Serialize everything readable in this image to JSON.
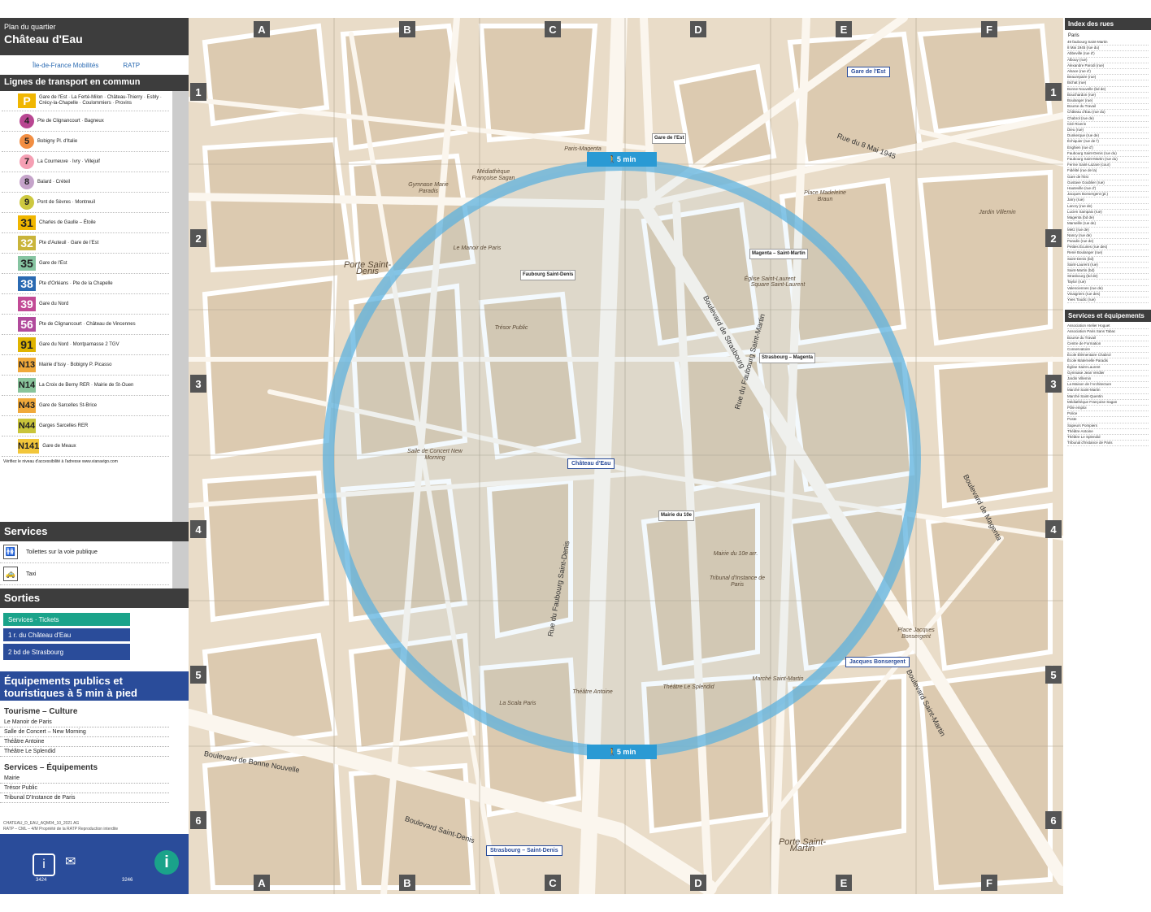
{
  "header": {
    "plan_label": "Plan du quartier",
    "place_name": "Château d'Eau",
    "logo_idf": "Île-de-France Mobilités",
    "logo_ratp": "RATP"
  },
  "transport": {
    "title": "Lignes de transport en commun",
    "rer_lines": [
      {
        "badge": "P",
        "dest": "Gare de l'Est · La Ferté-Milon · Château-Thierry · Esbly · Crécy-la-Chapelle · Coulommiers · Provins"
      }
    ],
    "metro_lines": [
      {
        "num": "4",
        "color": "#b94792",
        "dest": "Pte de Clignancourt · Bagneux"
      },
      {
        "num": "5",
        "color": "#f28e42",
        "dest": "Bobigny Pl. d'Italie"
      },
      {
        "num": "7",
        "color": "#f59fb3",
        "dest": "La Courneuve · Ivry · Villejuif"
      },
      {
        "num": "8",
        "color": "#c5a3ca",
        "dest": "Balard · Créteil"
      },
      {
        "num": "9",
        "color": "#cdc83f",
        "dest": "Pont de Sèvres · Montreuil"
      }
    ],
    "bus_lines": [
      {
        "num": "31",
        "color": "#f0b600",
        "text": "#222",
        "dest": "Charles de Gaulle – Étoile"
      },
      {
        "num": "32",
        "color": "#c9b43a",
        "text": "#fff",
        "dest": "Pte d'Auteuil · Gare de l'Est"
      },
      {
        "num": "35",
        "color": "#86c4a1",
        "text": "#222",
        "dest": "Gare de l'Est"
      },
      {
        "num": "38",
        "color": "#2a6ab2",
        "text": "#fff",
        "dest": "Pte d'Orléans · Pte de la Chapelle"
      },
      {
        "num": "39",
        "color": "#c24a96",
        "text": "#fff",
        "dest": "Gare du Nord"
      },
      {
        "num": "56",
        "color": "#b14a9c",
        "text": "#fff",
        "dest": "Pte de Clignancourt · Château de Vincennes"
      },
      {
        "num": "91",
        "color": "#e0b400",
        "text": "#222",
        "dest": "Gare du Nord · Montparnasse 2 TGV"
      }
    ],
    "noctilien_lines": [
      {
        "num": "N13",
        "color": "#f0a93a",
        "dest": "Mairie d'Issy · Bobigny P. Picasso"
      },
      {
        "num": "N14",
        "color": "#88c49b",
        "dest": "La Croix de Berny RER · Mairie de St-Ouen"
      },
      {
        "num": "N43",
        "color": "#f0a93a",
        "dest": "Gare de Sarcelles St-Brice"
      },
      {
        "num": "N44",
        "color": "#c9c43a",
        "dest": "Garges Sarcelles RER"
      },
      {
        "num": "N141",
        "color": "#f2c63a",
        "dest": "Gare de Meaux"
      }
    ],
    "note": "Vérifiez le niveau d'accessibilité à l'adresse www.vianavigo.com"
  },
  "services": {
    "title": "Services",
    "items": [
      {
        "icon": "toilet-icon",
        "label": "Toilettes sur la voie publique"
      },
      {
        "icon": "taxi-icon",
        "label": "Taxi"
      }
    ]
  },
  "exits": {
    "title": "Sorties",
    "items": [
      {
        "label": "Services · Tickets",
        "color": "#1aa38a"
      },
      {
        "label": "1  r. du Château d'Eau",
        "color": "#2a4c9a"
      },
      {
        "label": "2  bd de Strasbourg",
        "color": "#2a4c9a"
      }
    ]
  },
  "public": {
    "title": "Équipements publics et touristiques à 5 min à pied",
    "culture_title": "Tourisme – Culture",
    "culture": [
      "Le Manoir de Paris",
      "Salle de Concert – New Morning",
      "Théâtre Antoine",
      "Théâtre Le Splendid"
    ],
    "equip_title": "Services – Équipements",
    "equip": [
      "Mairie",
      "Trésor Public",
      "Tribunal D'Instance de Paris"
    ]
  },
  "footer": {
    "ref": "CHATEAU_D_EAU_AQM04_10_2021 AG",
    "copyright": "RATP – CML – 4/M Propriété de la RATP Reproduction interdite",
    "phone1": "3424",
    "phone2": "3246"
  },
  "map": {
    "columns": [
      "A",
      "B",
      "C",
      "D",
      "E",
      "F"
    ],
    "rows": [
      "1",
      "2",
      "3",
      "4",
      "5",
      "6"
    ],
    "walk_label": "5 min",
    "station_main": "Château d'Eau",
    "station_2": "Jacques Bonsergent",
    "station_3": "Strasbourg – Saint-Denis",
    "station_4": "Gare de l'Est",
    "bus_stops": [
      "Gare de l'Est",
      "Faubourg Saint-Denis",
      "Magenta – Saint-Martin",
      "Strasbourg – Magenta",
      "Mairie du 10e"
    ],
    "places": [
      "Porte Saint-Denis",
      "Porte Saint-Martin",
      "Place Madeleine Braun",
      "Place Jacques Bonsergent",
      "Square Saint-Laurent",
      "Trésor Public",
      "Salle de Concert New Morning",
      "Théâtre Antoine",
      "Théâtre Le Splendid",
      "Mairie du 10e arr.",
      "Tribunal d'Instance de Paris",
      "Marché Saint-Martin",
      "Paris-Magenta",
      "Le Manoir de Paris",
      "Gymnase Marie Paradis",
      "Médiathèque Françoise Sagan",
      "Église Saint-Laurent",
      "Jardin Villemin",
      "La Scala Paris"
    ],
    "streets": [
      "Boulevard de Strasbourg",
      "Boulevard de Magenta",
      "Rue du Faubourg Saint-Denis",
      "Rue du Faubourg Saint-Martin",
      "Boulevard de Bonne Nouvelle",
      "Boulevard Saint-Denis",
      "Rue du 8 Mai 1945",
      "Boulevard Saint-Martin"
    ]
  },
  "index": {
    "streets_title": "Index des rues",
    "city": "Paris",
    "streets": [
      "49 faubourg Saint-Martin",
      "8 Mai 1945 (rue du)",
      "Abbeville (rue d')",
      "Albouy (rue)",
      "Alexandre Parodi (rue)",
      "Alsace (rue d')",
      "Beaurepaire (rue)",
      "Bichat (rue)",
      "Bonne Nouvelle (bd de)",
      "Bouchardon (rue)",
      "Boulanger (rue)",
      "Bourse du Travail",
      "Château d'Eau (rue du)",
      "Chabrol (rue de)",
      "Cité Riverin",
      "Dieu (rue)",
      "Dunkerque (rue de)",
      "Échiquier (rue de l')",
      "Enghien (rue d')",
      "Faubourg Saint-Denis (rue du)",
      "Faubourg Saint-Martin (rue du)",
      "Ferme Saint-Lazare (cour)",
      "Fidélité (rue de la)",
      "Gare de l'Est",
      "Gustave Goublier (rue)",
      "Hauteville (rue d')",
      "Jacques Bonsergent (pl.)",
      "Jarry (rue)",
      "Lancry (rue de)",
      "Lucien Sampaix (rue)",
      "Magenta (bd de)",
      "Marseille (rue de)",
      "Metz (rue de)",
      "Nancy (rue de)",
      "Paradis (rue de)",
      "Petites Écuries (rue des)",
      "René Boulanger (rue)",
      "Saint-Denis (bd)",
      "Saint-Laurent (rue)",
      "Saint-Martin (bd)",
      "Strasbourg (bd de)",
      "Taylor (rue)",
      "Valenciennes (rue de)",
      "Vinaigriers (rue des)",
      "Yves Toudic (rue)"
    ],
    "services_title": "Services et équipements",
    "services": [
      "Association Atelier Hoguet",
      "Association Paris Sans Tabac",
      "Bourse du Travail",
      "Centre de Formation",
      "Conservatoire",
      "École Élémentaire Chabrol",
      "École Maternelle Paradis",
      "Église Saint-Laurent",
      "Gymnase Jean Verdier",
      "Jardin Villemin",
      "La Maison de l'Architecture",
      "Marché Saint-Martin",
      "Marché Saint-Quentin",
      "Médiathèque Françoise Sagan",
      "Pôle emploi",
      "Police",
      "Poste",
      "Sapeurs Pompiers",
      "Théâtre Antoine",
      "Théâtre Le Splendid",
      "Tribunal d'Instance de Paris"
    ]
  }
}
